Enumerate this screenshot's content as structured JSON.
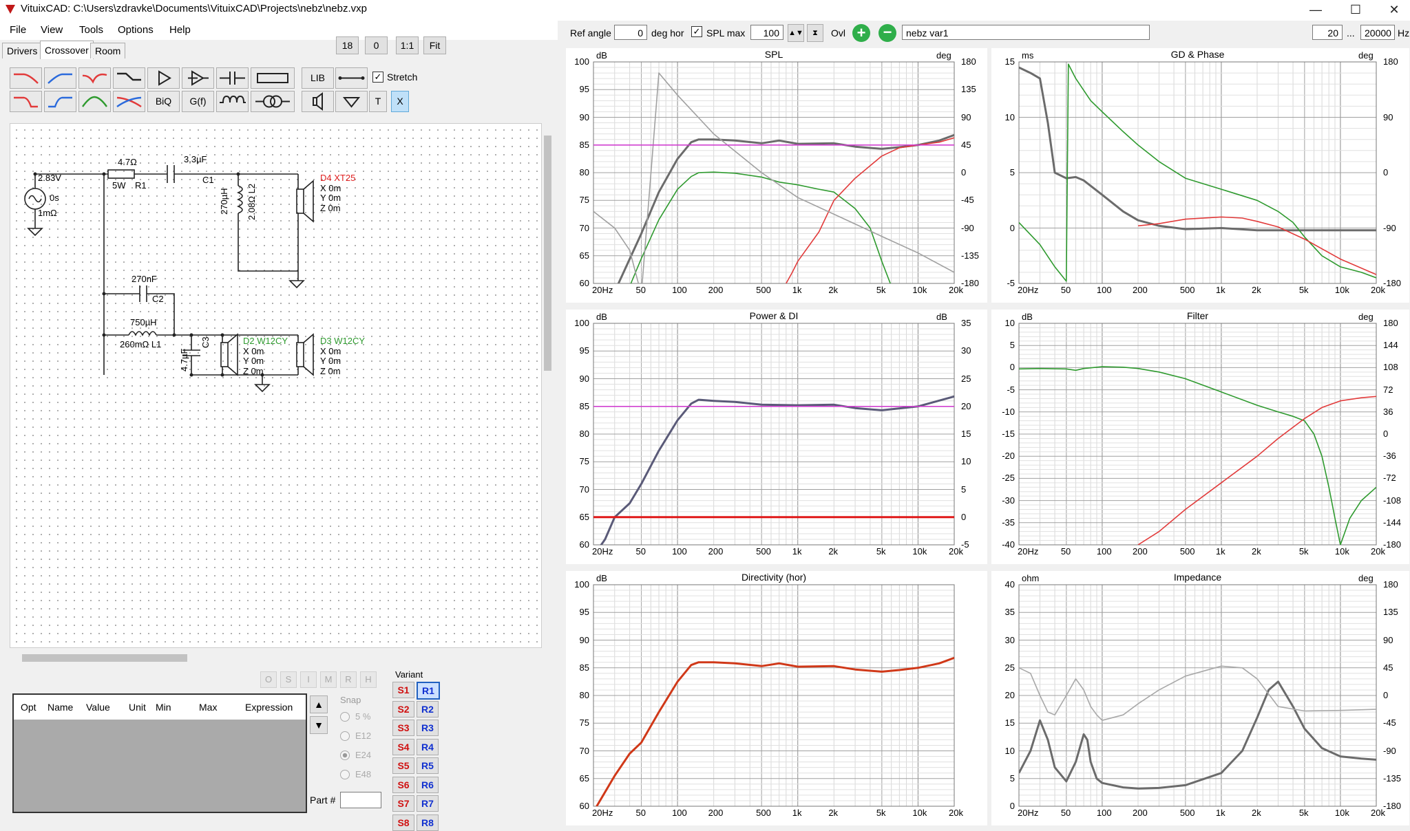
{
  "window": {
    "title": "VituixCAD: C:\\Users\\zdravke\\Documents\\VituixCAD\\Projects\\nebz\\nebz.vxp",
    "min": "—",
    "max": "☐",
    "close": "✕"
  },
  "menu": [
    "File",
    "View",
    "Tools",
    "Options",
    "Help"
  ],
  "tabs": [
    "Drivers",
    "Crossover",
    "Room"
  ],
  "zoom_buttons": {
    "grid": "18",
    "offset": "0",
    "one_to_one": "1:1",
    "fit": "Fit"
  },
  "toolbar": {
    "lib": "LIB",
    "biq": "BiQ",
    "gf": "G(f)",
    "t": "T",
    "x": "X",
    "stretch_label": "Stretch",
    "stretch_checked": true
  },
  "schematic": {
    "source": {
      "voltage": "2.83V",
      "delay": "0s",
      "impedance": "1mΩ"
    },
    "r1": {
      "value": "4.7Ω",
      "power": "5W",
      "name": "R1"
    },
    "c1": {
      "value": "3.3µF",
      "name": "C1"
    },
    "l2": {
      "value": "270µH",
      "name": "2.08Ω L2"
    },
    "d4": {
      "name": "D4 XT25",
      "x": "X 0m",
      "y": "Y 0m",
      "z": "Z 0m"
    },
    "c2": {
      "value": "270nF",
      "name": "C2"
    },
    "l1": {
      "value": "750µH",
      "name": "260mΩ L1"
    },
    "c3": {
      "value": "4.7µF",
      "name": "C3"
    },
    "d2": {
      "name": "D2 W12CY",
      "x": "X 0m",
      "y": "Y 0m",
      "z": "Z 0m"
    },
    "d3": {
      "name": "D3 W12CY",
      "x": "X 0m",
      "y": "Y 0m",
      "z": "Z 0m"
    }
  },
  "param_table": {
    "columns": [
      "Opt",
      "Name",
      "Value",
      "Unit",
      "Min",
      "Max",
      "Expression"
    ],
    "mode_buttons": [
      "O",
      "S",
      "I",
      "M",
      "R",
      "H"
    ]
  },
  "snap": {
    "label": "Snap",
    "options": [
      "5 %",
      "E12",
      "E24",
      "E48"
    ],
    "selected": "E24"
  },
  "part_label": "Part #",
  "variant": {
    "label": "Variant",
    "s": [
      "S1",
      "S2",
      "S3",
      "S4",
      "S5",
      "S6",
      "S7",
      "S8"
    ],
    "r": [
      "R1",
      "R2",
      "R3",
      "R4",
      "R5",
      "R6",
      "R7",
      "R8"
    ],
    "selected": "R1"
  },
  "topbar": {
    "ref_angle_label": "Ref angle",
    "ref_angle_value": "0",
    "deg_hor": "deg hor",
    "spl_max_label": "SPL max",
    "spl_max_checked": true,
    "spl_max_value": "100",
    "ovl": "Ovl",
    "overlay_name": "nebz var1",
    "f_min": "20",
    "range_sep": "...",
    "f_max": "20000",
    "hz": "Hz"
  },
  "chart_data": [
    {
      "type": "line",
      "title": "SPL",
      "xlabel": "",
      "ylabel": "dB",
      "y2label": "deg",
      "x_scale": "log",
      "xlim": [
        20,
        20000
      ],
      "ylim": [
        60,
        100
      ],
      "y2lim": [
        -180,
        180
      ],
      "x_ticks": [
        "20Hz",
        "50",
        "100",
        "200",
        "500",
        "1k",
        "2k",
        "5k",
        "10k",
        "20k"
      ],
      "y_ticks": [
        "100",
        "95",
        "90",
        "85",
        "80",
        "75",
        "70",
        "65",
        "60"
      ],
      "y2_ticks": [
        "180",
        "135",
        "90",
        "45",
        "0",
        "-45",
        "-90",
        "-135",
        "-180"
      ],
      "colors": {
        "total": "#6b6b6b",
        "woofer": "#2e9a2e",
        "tweeter": "#e23a3a",
        "phase": "#a0a0a0",
        "reference": "#d040d0"
      },
      "series": [
        {
          "name": "",
          "color": "#6b6b6b",
          "x": [
            20,
            30,
            50,
            70,
            100,
            130,
            150,
            200,
            300,
            500,
            700,
            1000,
            2000,
            3000,
            5000,
            7000,
            10000,
            15000,
            20000
          ],
          "y": [
            53,
            58.5,
            69,
            76.5,
            82.5,
            85.5,
            86,
            86,
            85.8,
            85.3,
            85.8,
            85.2,
            85.3,
            84.7,
            84.3,
            84.6,
            85,
            85.8,
            86.8
          ]
        },
        {
          "name": "",
          "color": "#2e9a2e",
          "x": [
            20,
            30,
            50,
            70,
            100,
            130,
            150,
            200,
            300,
            500,
            700,
            1000,
            1500,
            2000,
            3000,
            4000,
            5000,
            6000
          ],
          "y": [
            48,
            53,
            64.5,
            71.5,
            77,
            79.3,
            80,
            80.1,
            79.9,
            79.2,
            78.3,
            77.8,
            77,
            76.5,
            73.5,
            70,
            64,
            59.5
          ]
        },
        {
          "name": "",
          "color": "#e23a3a",
          "x": [
            800,
            900,
            1000,
            1500,
            2000,
            3000,
            5000,
            7000,
            10000,
            15000,
            20000
          ],
          "y": [
            60,
            62,
            64,
            69.3,
            75,
            79,
            83,
            84.5,
            85,
            85.5,
            86.3
          ]
        },
        {
          "name": "",
          "color": "#a0a0a0",
          "x": [
            20,
            30,
            40,
            50,
            70,
            100,
            200,
            500,
            1000,
            2000,
            5000,
            10000,
            20000
          ],
          "y": [
            73,
            70,
            66,
            58,
            98,
            94,
            87,
            80,
            75.5,
            72.5,
            68.5,
            65.5,
            62
          ]
        },
        {
          "name": "",
          "color": "#d040d0",
          "x": [
            20,
            20000
          ],
          "y": [
            85,
            85
          ]
        }
      ]
    },
    {
      "type": "line",
      "title": "GD & Phase",
      "xlabel": "",
      "ylabel": "ms",
      "y2label": "deg",
      "x_scale": "log",
      "xlim": [
        20,
        20000
      ],
      "ylim": [
        -5,
        15
      ],
      "y2lim": [
        -180,
        180
      ],
      "x_ticks": [
        "20Hz",
        "50",
        "100",
        "200",
        "500",
        "1k",
        "2k",
        "5k",
        "10k",
        "20k"
      ],
      "y_ticks": [
        "15",
        "10",
        "5",
        "0",
        "-5"
      ],
      "y2_ticks": [
        "180",
        "90",
        "0",
        "-90",
        "-180"
      ],
      "series": [
        {
          "name": "",
          "color": "#6b6b6b",
          "x": [
            20,
            25,
            30,
            35,
            40,
            50,
            60,
            70,
            100,
            150,
            200,
            300,
            500,
            1000,
            2000,
            5000,
            10000,
            20000
          ],
          "y": [
            14.5,
            14,
            13.5,
            9.5,
            5,
            4.5,
            4.6,
            4.3,
            3,
            1.5,
            0.7,
            0.2,
            -0.1,
            0,
            -0.2,
            -0.2,
            -0.2,
            -0.2
          ]
        },
        {
          "name": "",
          "color": "#2e9a2e",
          "x": [
            20,
            30,
            40,
            50,
            52,
            60,
            80,
            100,
            150,
            200,
            300,
            500,
            1000,
            2000,
            3000,
            4000,
            5000,
            7000,
            10000,
            15000,
            20000
          ],
          "y": [
            0.5,
            -1.5,
            -3.5,
            -4.8,
            14.8,
            13.5,
            11.5,
            10.5,
            8.7,
            7.5,
            6,
            4.5,
            3.5,
            2.5,
            1.5,
            0.5,
            -0.8,
            -2.5,
            -3.5,
            -4,
            -4.5
          ]
        },
        {
          "name": "",
          "color": "#e23a3a",
          "x": [
            200,
            300,
            500,
            1000,
            1500,
            2000,
            3000,
            5000,
            10000,
            20000
          ],
          "y": [
            0.2,
            0.4,
            0.8,
            1,
            0.9,
            0.6,
            0.1,
            -1,
            -2.8,
            -4.2
          ]
        }
      ]
    },
    {
      "type": "line",
      "title": "Power & DI",
      "xlabel": "",
      "ylabel": "dB",
      "y2label": "dB",
      "x_scale": "log",
      "xlim": [
        20,
        20000
      ],
      "ylim": [
        60,
        100
      ],
      "y2lim": [
        -5,
        35
      ],
      "x_ticks": [
        "20Hz",
        "50",
        "100",
        "200",
        "500",
        "1k",
        "2k",
        "5k",
        "10k",
        "20k"
      ],
      "y_ticks": [
        "100",
        "95",
        "90",
        "85",
        "80",
        "75",
        "70",
        "65",
        "60"
      ],
      "y2_ticks": [
        "35",
        "30",
        "25",
        "20",
        "15",
        "10",
        "5",
        "0",
        "-5"
      ],
      "series": [
        {
          "name": "",
          "color": "#5a5a78",
          "x": [
            20,
            25,
            30,
            40,
            50,
            70,
            100,
            130,
            150,
            200,
            300,
            500,
            1000,
            2000,
            3000,
            5000,
            10000,
            20000
          ],
          "y": [
            58,
            61,
            65,
            67.5,
            71,
            77,
            82.5,
            85.5,
            86.2,
            86,
            85.8,
            85.3,
            85.2,
            85.3,
            84.7,
            84.3,
            85,
            86.8
          ]
        },
        {
          "name": "",
          "color": "#d040d0",
          "x": [
            20,
            20000
          ],
          "y": [
            85,
            85
          ]
        },
        {
          "name": "",
          "color": "#e01818",
          "x": [
            20,
            20000
          ],
          "y": [
            65,
            65
          ]
        }
      ]
    },
    {
      "type": "line",
      "title": "Filter",
      "xlabel": "",
      "ylabel": "dB",
      "y2label": "deg",
      "x_scale": "log",
      "xlim": [
        20,
        20000
      ],
      "ylim": [
        -40,
        10
      ],
      "y2lim": [
        -180,
        180
      ],
      "x_ticks": [
        "20Hz",
        "50",
        "100",
        "200",
        "500",
        "1k",
        "2k",
        "5k",
        "10k",
        "20k"
      ],
      "y_ticks": [
        "10",
        "5",
        "0",
        "-5",
        "-10",
        "-15",
        "-20",
        "-25",
        "-30",
        "-35",
        "-40"
      ],
      "y2_ticks": [
        "180",
        "144",
        "108",
        "72",
        "36",
        "0",
        "-36",
        "-72",
        "-108",
        "-144",
        "-180"
      ],
      "series": [
        {
          "name": "",
          "color": "#2e9a2e",
          "x": [
            20,
            30,
            50,
            60,
            70,
            100,
            150,
            200,
            300,
            500,
            1000,
            2000,
            3000,
            4000,
            5000,
            6000,
            7000,
            8000,
            9000,
            10000,
            12000,
            15000,
            20000
          ],
          "y": [
            -0.3,
            -0.2,
            -0.3,
            -0.6,
            -0.2,
            0.2,
            0.1,
            -0.2,
            -1,
            -2.5,
            -5.5,
            -8.5,
            -10,
            -11,
            -12,
            -15,
            -20,
            -27,
            -34,
            -40,
            -34,
            -30,
            -27
          ]
        },
        {
          "name": "",
          "color": "#e23a3a",
          "x": [
            200,
            300,
            500,
            1000,
            2000,
            3000,
            5000,
            7000,
            10000,
            15000,
            20000
          ],
          "y": [
            -40,
            -37,
            -32,
            -26,
            -20,
            -16,
            -11.5,
            -9,
            -7.5,
            -6.8,
            -6.5
          ]
        }
      ]
    },
    {
      "type": "line",
      "title": "Directivity (hor)",
      "xlabel": "",
      "ylabel": "dB",
      "x_scale": "log",
      "xlim": [
        20,
        20000
      ],
      "ylim": [
        60,
        100
      ],
      "x_ticks": [
        "20Hz",
        "50",
        "100",
        "200",
        "500",
        "1k",
        "2k",
        "5k",
        "10k",
        "20k"
      ],
      "y_ticks": [
        "100",
        "95",
        "90",
        "85",
        "80",
        "75",
        "70",
        "65",
        "60"
      ],
      "series": [
        {
          "name": "",
          "color": "#d03818",
          "x": [
            20,
            30,
            40,
            50,
            70,
            100,
            130,
            150,
            200,
            300,
            500,
            700,
            1000,
            2000,
            3000,
            5000,
            7000,
            10000,
            15000,
            20000
          ],
          "y": [
            59,
            65.5,
            69.5,
            71.5,
            77,
            82.5,
            85.5,
            86,
            86,
            85.8,
            85.3,
            85.8,
            85.2,
            85.3,
            84.7,
            84.3,
            84.6,
            85,
            85.8,
            86.8
          ]
        }
      ]
    },
    {
      "type": "line",
      "title": "Impedance",
      "xlabel": "",
      "ylabel": "ohm",
      "y2label": "deg",
      "x_scale": "log",
      "xlim": [
        20,
        20000
      ],
      "ylim": [
        0,
        40
      ],
      "y2lim": [
        -180,
        180
      ],
      "x_ticks": [
        "20Hz",
        "50",
        "100",
        "200",
        "500",
        "1k",
        "2k",
        "5k",
        "10k",
        "20k"
      ],
      "y_ticks": [
        "40",
        "35",
        "30",
        "25",
        "20",
        "15",
        "10",
        "5",
        "0"
      ],
      "y2_ticks": [
        "180",
        "135",
        "90",
        "45",
        "0",
        "-45",
        "-90",
        "-135",
        "-180"
      ],
      "series": [
        {
          "name": "",
          "color": "#6b6b6b",
          "x": [
            20,
            25,
            30,
            35,
            40,
            50,
            60,
            70,
            75,
            80,
            90,
            100,
            150,
            200,
            300,
            500,
            1000,
            1500,
            2000,
            2500,
            3000,
            4000,
            5000,
            7000,
            10000,
            15000,
            20000
          ],
          "y": [
            6,
            10,
            15.5,
            12,
            7,
            4.5,
            8,
            13,
            12,
            8,
            5,
            4.2,
            3.4,
            3.2,
            3.3,
            3.8,
            6,
            10,
            16,
            21,
            22.5,
            18,
            14,
            10.5,
            9,
            8.6,
            8.4
          ]
        },
        {
          "name": "",
          "color": "#a8a8a8",
          "x": [
            20,
            25,
            30,
            35,
            40,
            50,
            60,
            70,
            80,
            90,
            100,
            150,
            200,
            300,
            500,
            1000,
            1500,
            2000,
            3000,
            5000,
            10000,
            20000
          ],
          "y": [
            25,
            24,
            20,
            17,
            16.5,
            20,
            23,
            21,
            18,
            16.5,
            15.5,
            16.5,
            18.5,
            21,
            23.5,
            25.3,
            25,
            23,
            18,
            17.2,
            17.3,
            17.5
          ]
        }
      ]
    }
  ]
}
